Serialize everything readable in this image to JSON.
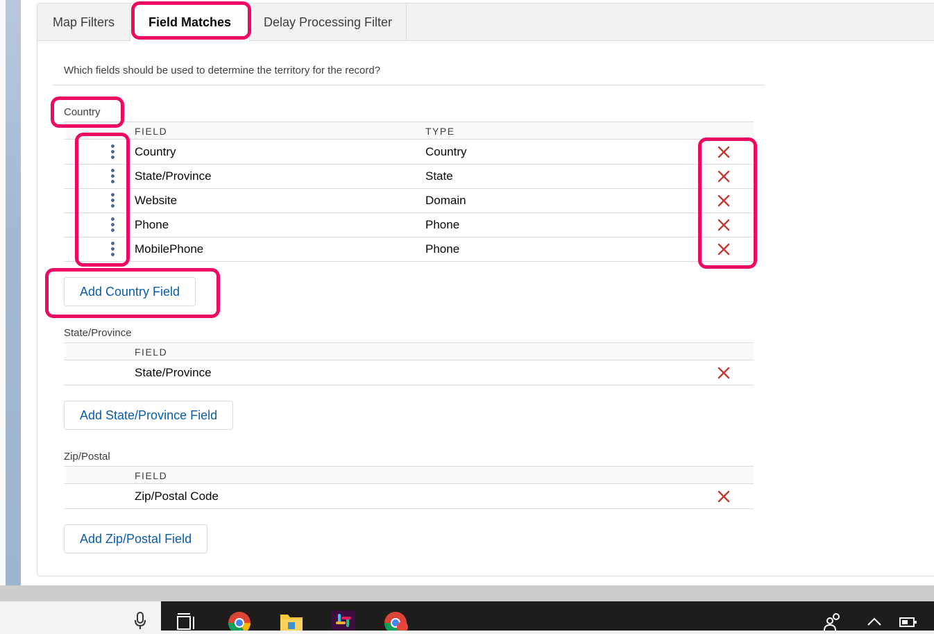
{
  "tabs": [
    {
      "label": "Map Filters"
    },
    {
      "label": "Field Matches",
      "active": true
    },
    {
      "label": "Delay Processing Filter"
    }
  ],
  "question": "Which fields should be used to determine the territory for the record?",
  "sections": {
    "country": {
      "label": "Country",
      "headers": {
        "field": "FIELD",
        "type": "TYPE"
      },
      "rows": [
        {
          "field": "Country",
          "type": "Country"
        },
        {
          "field": "State/Province",
          "type": "State"
        },
        {
          "field": "Website",
          "type": "Domain"
        },
        {
          "field": "Phone",
          "type": "Phone"
        },
        {
          "field": "MobilePhone",
          "type": "Phone"
        }
      ],
      "add_button": "Add Country Field"
    },
    "state": {
      "label": "State/Province",
      "headers": {
        "field": "FIELD"
      },
      "rows": [
        {
          "field": "State/Province"
        }
      ],
      "add_button": "Add State/Province Field"
    },
    "zip": {
      "label": "Zip/Postal",
      "headers": {
        "field": "FIELD"
      },
      "rows": [
        {
          "field": "Zip/Postal Code"
        }
      ],
      "add_button": "Add Zip/Postal Field"
    }
  },
  "icons": {
    "delete": "close-icon",
    "drag": "drag-handle-icon"
  },
  "colors": {
    "highlight": "#ee0a62",
    "delete": "#c23934",
    "link": "#0b5cab"
  }
}
